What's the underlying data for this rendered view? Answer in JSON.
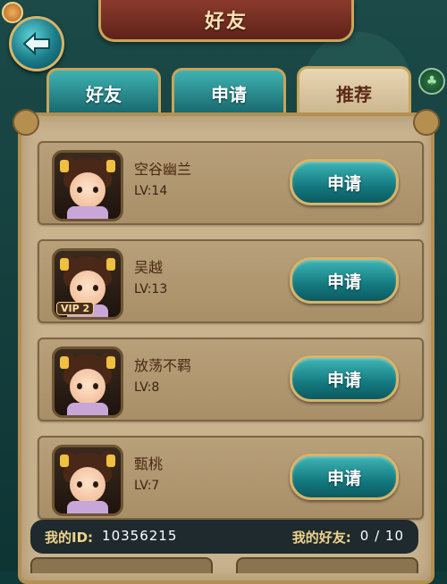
{
  "header": {
    "title": "好友"
  },
  "tabs": [
    {
      "label": "好友",
      "active": false
    },
    {
      "label": "申请",
      "active": false
    },
    {
      "label": "推荐",
      "active": true
    }
  ],
  "friends": [
    {
      "name": "空谷幽兰",
      "level": "LV:14",
      "vip": "",
      "action": "申请"
    },
    {
      "name": "吴越",
      "level": "LV:13",
      "vip": "VIP 2",
      "action": "申请"
    },
    {
      "name": "放荡不羁",
      "level": "LV:8",
      "vip": "",
      "action": "申请"
    },
    {
      "name": "甄桃",
      "level": "LV:7",
      "vip": "",
      "action": "申请"
    }
  ],
  "footer": {
    "id_label": "我的ID:",
    "id_value": "10356215",
    "friends_label": "我的好友:",
    "friends_value": "0 / 10"
  },
  "icons": {
    "back": "back-arrow-icon",
    "clover": "clover-icon",
    "player_avatar": "player-avatar-icon"
  },
  "colors": {
    "accent_teal": "#137a80",
    "gold_border": "#c9a45a",
    "title_red": "#8b3a2c"
  }
}
